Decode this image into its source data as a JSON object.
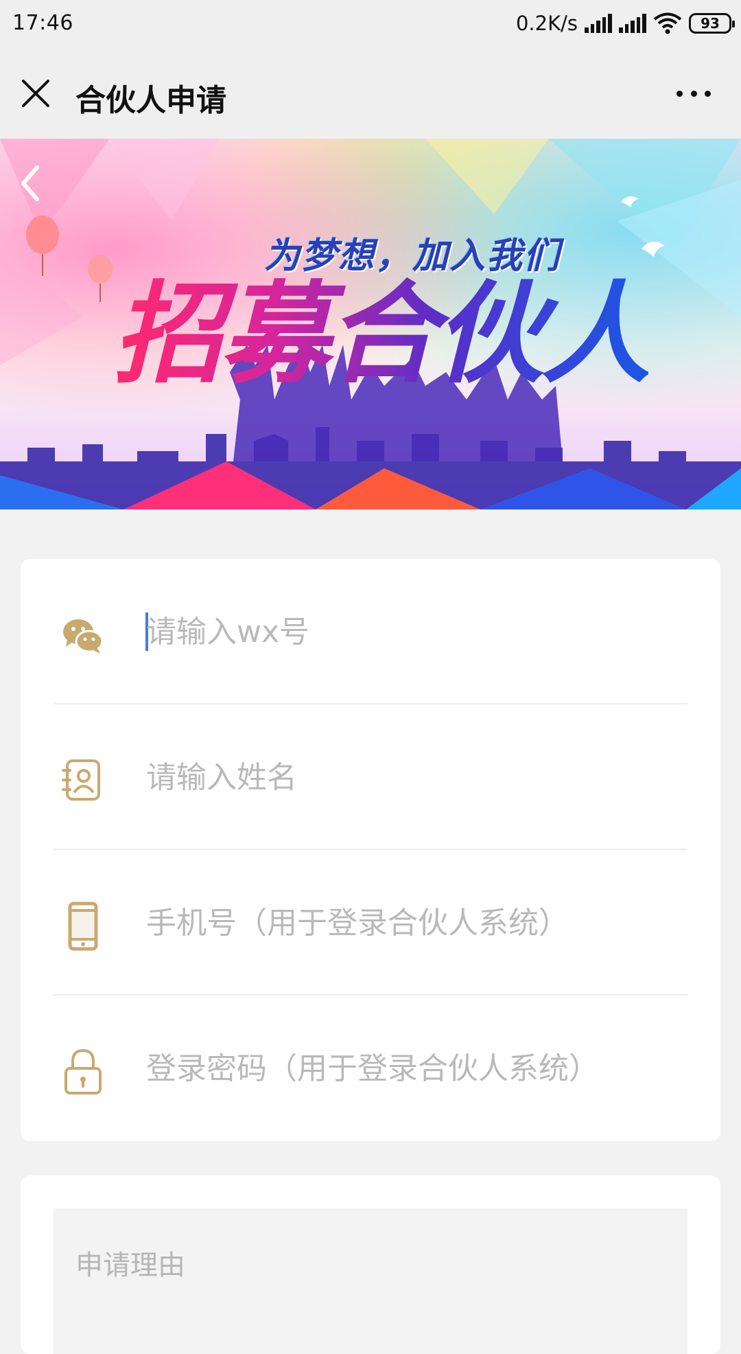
{
  "status_bar": {
    "time": "17:46",
    "net_speed": "0.2K/s",
    "battery": "93"
  },
  "nav": {
    "title": "合伙人申请"
  },
  "banner": {
    "slogan": "为梦想，加入我们",
    "headline": "招募合伙人"
  },
  "form": {
    "fields": [
      {
        "icon": "wechat-icon",
        "placeholder": "请输入wx号"
      },
      {
        "icon": "contact-card-icon",
        "placeholder": "请输入姓名"
      },
      {
        "icon": "phone-icon",
        "placeholder": "手机号（用于登录合伙人系统）"
      },
      {
        "icon": "lock-icon",
        "placeholder": "登录密码（用于登录合伙人系统）"
      }
    ]
  },
  "reason": {
    "placeholder": "申请理由"
  },
  "colors": {
    "icon_gold": "#c8a96e",
    "caret_blue": "#3d7fe0",
    "page_bg": "#f2f2f2"
  }
}
